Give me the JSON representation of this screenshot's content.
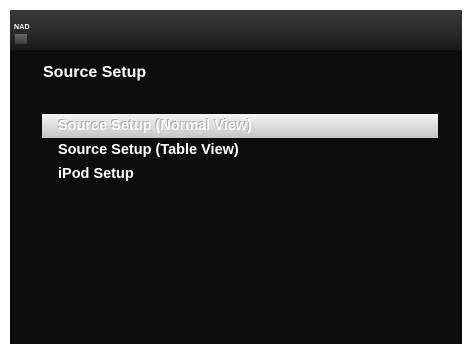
{
  "header": {
    "brand": "NAD"
  },
  "page": {
    "title": "Source Setup"
  },
  "menu": {
    "items": [
      {
        "label": "Source Setup (Normal View)",
        "selected": true
      },
      {
        "label": "Source Setup (Table View)",
        "selected": false
      },
      {
        "label": "iPod Setup",
        "selected": false
      }
    ]
  },
  "colors": {
    "background": "#0c0c0c",
    "header_bar": "#2a2a2a",
    "text": "#ffffff",
    "selection_highlight": "#dcdcdc"
  }
}
